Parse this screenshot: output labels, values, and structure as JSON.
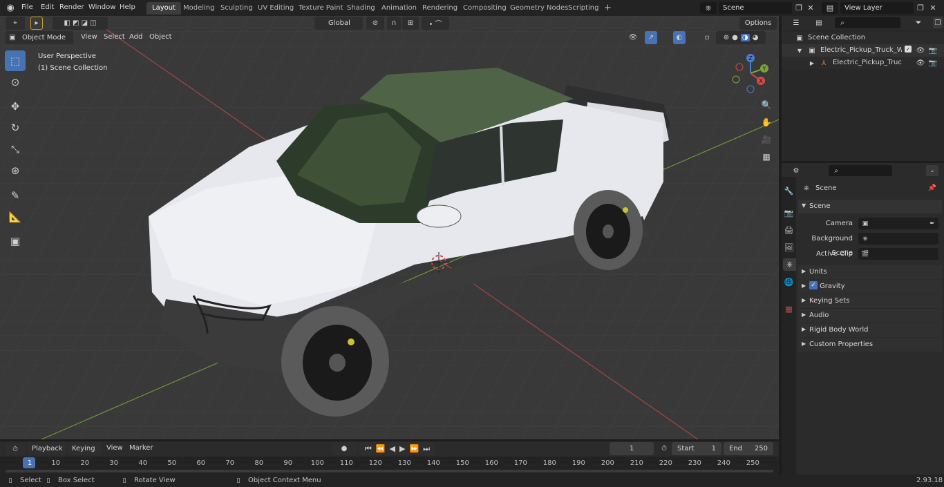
{
  "menu": [
    "File",
    "Edit",
    "Render",
    "Window",
    "Help"
  ],
  "workspaces": [
    "Layout",
    "Modeling",
    "Sculpting",
    "UV Editing",
    "Texture Paint",
    "Shading",
    "Animation",
    "Rendering",
    "Compositing",
    "Geometry Nodes",
    "Scripting"
  ],
  "add_workspace": "+",
  "scene_field": "Scene",
  "view_layer_field": "View Layer",
  "viewport_header": {
    "mode": "Object Mode",
    "menus": [
      "View",
      "Select",
      "Add",
      "Object"
    ],
    "orientation": "Global",
    "options": "Options"
  },
  "overlay_text": {
    "perspective": "User Perspective",
    "collection": "(1) Scene Collection"
  },
  "gizmo_labels": {
    "z": "Z",
    "y": "Y",
    "x": "X"
  },
  "outliner": {
    "root": "Scene Collection",
    "items": [
      "Electric_Pickup_Truck_White_(",
      "Electric_Pickup_Truck_Wh"
    ]
  },
  "properties": {
    "context": "Scene",
    "section": "Scene",
    "fields": [
      {
        "label": "Camera",
        "value": ""
      },
      {
        "label": "Background Scene",
        "value": ""
      },
      {
        "label": "Active Clip",
        "value": ""
      }
    ],
    "panels": [
      "Units",
      "Gravity",
      "Keying Sets",
      "Audio",
      "Rigid Body World",
      "Custom Properties"
    ]
  },
  "timeline": {
    "menus": [
      "Playback",
      "Keying",
      "View",
      "Marker"
    ],
    "current_frame": "1",
    "start_label": "Start",
    "start": "1",
    "end_label": "End",
    "end": "250",
    "ticks": [
      "1",
      "10",
      "20",
      "30",
      "40",
      "50",
      "60",
      "70",
      "80",
      "90",
      "100",
      "110",
      "120",
      "130",
      "140",
      "150",
      "160",
      "170",
      "180",
      "190",
      "200",
      "210",
      "220",
      "230",
      "240",
      "250"
    ]
  },
  "statusbar": {
    "select": "Select",
    "box_select": "Box Select",
    "rotate": "Rotate View",
    "context_menu": "Object Context Menu",
    "version": "2.93.18"
  },
  "colors": {
    "accent": "#4772b3",
    "viewport_bg": "#393939",
    "x_axis": "#d24a4a",
    "y_axis": "#7aa33b"
  }
}
